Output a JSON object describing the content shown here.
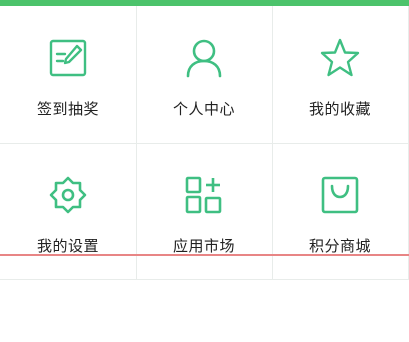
{
  "colors": {
    "accent": "#4cc36b",
    "icon": "#3fbf82",
    "text": "#222222",
    "divider": "#e8ecea",
    "red_line": "#e88585"
  },
  "grid": {
    "items": [
      {
        "label": "签到抽奖",
        "icon": "edit-note-icon"
      },
      {
        "label": "个人中心",
        "icon": "user-icon"
      },
      {
        "label": "我的收藏",
        "icon": "star-icon"
      },
      {
        "label": "我的设置",
        "icon": "gear-icon"
      },
      {
        "label": "应用市场",
        "icon": "apps-grid-icon"
      },
      {
        "label": "积分商城",
        "icon": "shopping-bag-icon"
      }
    ]
  }
}
